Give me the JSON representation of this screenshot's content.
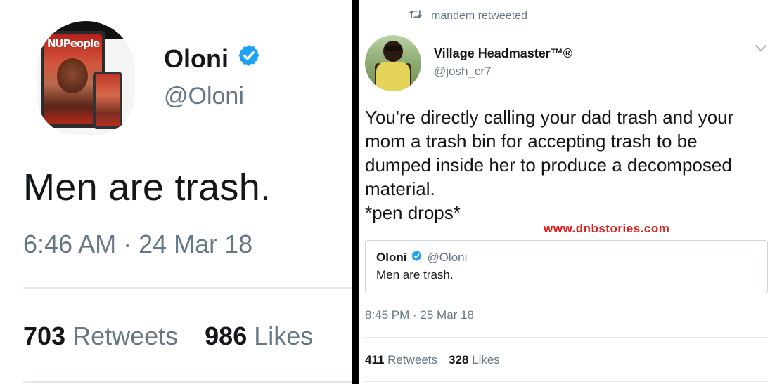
{
  "left_tweet": {
    "author_name": "Oloni",
    "author_handle": "@Oloni",
    "text": "Men are trash.",
    "timestamp": "6:46 AM · 24 Mar 18",
    "retweets_count": "703",
    "retweets_label": "Retweets",
    "likes_count": "986",
    "likes_label": "Likes",
    "verified": true,
    "avatar_text": "NUPeople"
  },
  "right_tweet": {
    "retweeted_by": "mandem retweeted",
    "author_name": "Village Headmaster™®",
    "author_handle": "@josh_cr7",
    "text_lines": [
      "You're directly calling your dad trash and your",
      "mom a trash bin for accepting trash to be",
      "dumped inside her to produce a decomposed",
      "material.",
      "*pen drops*"
    ],
    "watermark": "www.dnbstories.com",
    "quoted": {
      "author_name": "Oloni",
      "author_handle": "@Oloni",
      "text": "Men are trash.",
      "verified": true
    },
    "timestamp": "8:45 PM · 25 Mar 18",
    "retweets_count": "411",
    "retweets_label": "Retweets",
    "likes_count": "328",
    "likes_label": "Likes"
  },
  "colors": {
    "verified_blue": "#1da1f2",
    "secondary_text": "#657786",
    "primary_text": "#14171a",
    "watermark_red": "#e0201d",
    "separator": "#000000"
  },
  "icons": [
    "verified-badge-icon",
    "retweet-icon",
    "chevron-down-icon"
  ]
}
